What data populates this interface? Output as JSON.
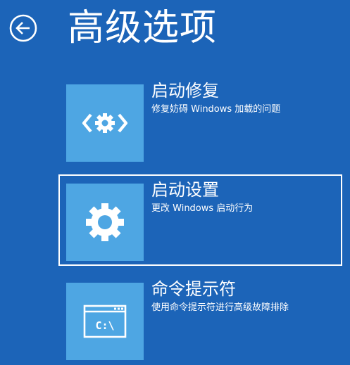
{
  "header": {
    "back_icon": "back-arrow-circle-icon",
    "title": "高级选项"
  },
  "options": [
    {
      "title": "启动修复",
      "description": "修复妨碍 Windows 加载的问题",
      "icon": "startup-repair-gear-brackets-icon",
      "selected": false
    },
    {
      "title": "启动设置",
      "description": "更改 Windows 启动行为",
      "icon": "gear-icon",
      "selected": true
    },
    {
      "title": "命令提示符",
      "description": "使用命令提示符进行高级故障排除",
      "icon": "command-prompt-icon",
      "icon_text": "C:\\",
      "selected": false
    }
  ],
  "colors": {
    "background": "#1c64b8",
    "tile": "#4ea6e3",
    "text": "#ffffff",
    "selection_border": "#ffffff"
  }
}
